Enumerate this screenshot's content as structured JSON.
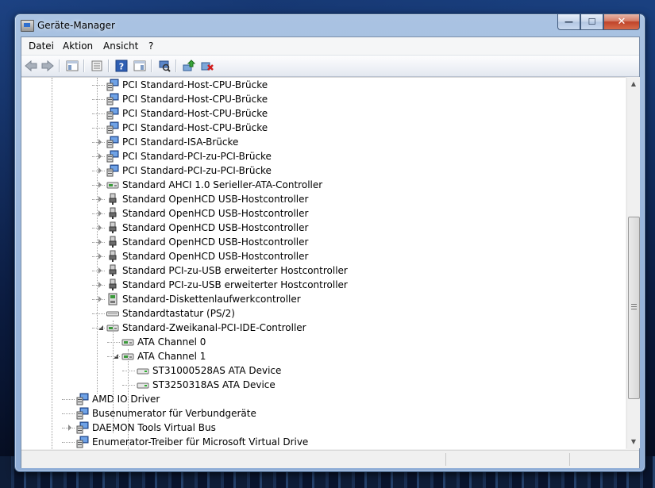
{
  "window": {
    "title": "Geräte-Manager"
  },
  "caption": {
    "minimize": "—",
    "maximize": "☐",
    "close": "✕"
  },
  "menu": [
    "Datei",
    "Aktion",
    "Ansicht",
    "?"
  ],
  "toolbar": [
    "back-icon",
    "forward-icon",
    "console-tree-icon",
    "properties-icon",
    "help-icon",
    "action-pane-icon",
    "scan-hardware-icon",
    "update-driver-icon",
    "uninstall-device-icon"
  ],
  "tree": [
    {
      "label": "PCI Standard-Host-CPU-Brücke",
      "icon": "pci-bridge",
      "depth": 2,
      "expander": "none"
    },
    {
      "label": "PCI Standard-Host-CPU-Brücke",
      "icon": "pci-bridge",
      "depth": 2,
      "expander": "none"
    },
    {
      "label": "PCI Standard-Host-CPU-Brücke",
      "icon": "pci-bridge",
      "depth": 2,
      "expander": "none"
    },
    {
      "label": "PCI Standard-Host-CPU-Brücke",
      "icon": "pci-bridge",
      "depth": 2,
      "expander": "none"
    },
    {
      "label": "PCI Standard-ISA-Brücke",
      "icon": "pci-bridge",
      "depth": 2,
      "expander": "closed"
    },
    {
      "label": "PCI Standard-PCI-zu-PCI-Brücke",
      "icon": "pci-bridge",
      "depth": 2,
      "expander": "closed"
    },
    {
      "label": "PCI Standard-PCI-zu-PCI-Brücke",
      "icon": "pci-bridge",
      "depth": 2,
      "expander": "closed"
    },
    {
      "label": "Standard AHCI 1.0 Serieller-ATA-Controller",
      "icon": "ide-controller",
      "depth": 2,
      "expander": "closed"
    },
    {
      "label": "Standard OpenHCD USB-Hostcontroller",
      "icon": "usb",
      "depth": 2,
      "expander": "closed"
    },
    {
      "label": "Standard OpenHCD USB-Hostcontroller",
      "icon": "usb",
      "depth": 2,
      "expander": "closed"
    },
    {
      "label": "Standard OpenHCD USB-Hostcontroller",
      "icon": "usb",
      "depth": 2,
      "expander": "closed"
    },
    {
      "label": "Standard OpenHCD USB-Hostcontroller",
      "icon": "usb",
      "depth": 2,
      "expander": "closed"
    },
    {
      "label": "Standard OpenHCD USB-Hostcontroller",
      "icon": "usb",
      "depth": 2,
      "expander": "closed"
    },
    {
      "label": "Standard PCI-zu-USB erweiterter Hostcontroller",
      "icon": "usb",
      "depth": 2,
      "expander": "closed"
    },
    {
      "label": "Standard PCI-zu-USB erweiterter Hostcontroller",
      "icon": "usb",
      "depth": 2,
      "expander": "closed"
    },
    {
      "label": "Standard-Diskettenlaufwerkcontroller",
      "icon": "floppy-controller",
      "depth": 2,
      "expander": "closed"
    },
    {
      "label": "Standardtastatur (PS/2)",
      "icon": "keyboard",
      "depth": 2,
      "expander": "none"
    },
    {
      "label": "Standard-Zweikanal-PCI-IDE-Controller",
      "icon": "ide-controller",
      "depth": 2,
      "expander": "open"
    },
    {
      "label": "ATA Channel 0",
      "icon": "ide-controller",
      "depth": 3,
      "expander": "none"
    },
    {
      "label": "ATA Channel 1",
      "icon": "ide-controller",
      "depth": 3,
      "expander": "open"
    },
    {
      "label": "ST31000528AS ATA Device",
      "icon": "disk",
      "depth": 4,
      "expander": "none"
    },
    {
      "label": "ST3250318AS ATA Device",
      "icon": "disk",
      "depth": 4,
      "expander": "none"
    },
    {
      "label": "AMD IO Driver",
      "icon": "pci-bridge",
      "depth": 0,
      "expander": "none"
    },
    {
      "label": "Busenumerator für Verbundgeräte",
      "icon": "pci-bridge",
      "depth": 0,
      "expander": "none"
    },
    {
      "label": "DAEMON Tools Virtual Bus",
      "icon": "pci-bridge",
      "depth": 0,
      "expander": "closed"
    },
    {
      "label": "Enumerator-Treiber für Microsoft Virtual Drive",
      "icon": "pci-bridge",
      "depth": 0,
      "expander": "none"
    }
  ],
  "colors": {
    "titlebar": "#9bb7dc",
    "close_button": "#c0432a",
    "tree_bg": "#ffffff",
    "client_bg": "#f0f0f0"
  }
}
